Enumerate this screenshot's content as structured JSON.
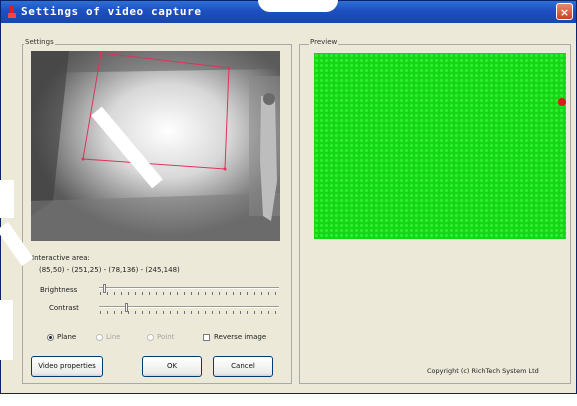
{
  "window": {
    "title": "Settings of video capture",
    "close_label": "×"
  },
  "settings": {
    "group_label": "Settings",
    "interactive_area_label": "Interactive area:",
    "interactive_area_value": "(85,50) - (251,25) - (78,136) - (245,148)",
    "brightness_label": "Brightness",
    "contrast_label": "Contrast",
    "brightness_value": 0.02,
    "contrast_value": 0.15,
    "radios": {
      "plane": "Plane",
      "line": "Line",
      "point": "Point"
    },
    "reverse_label": "Reverse image",
    "selected_mode": "Plane"
  },
  "preview": {
    "group_label": "Preview",
    "copyright": "Copyright (c) RichTech System Ltd"
  },
  "buttons": {
    "video_properties": "Video properties",
    "ok": "OK",
    "cancel": "Cancel"
  },
  "colors": {
    "preview_green": "#16d416",
    "marker_red": "#e01818",
    "region_outline": "#e0325a",
    "titlebar": "#1c4fbf"
  },
  "icons": {
    "title": "app-icon",
    "close": "close-icon"
  }
}
